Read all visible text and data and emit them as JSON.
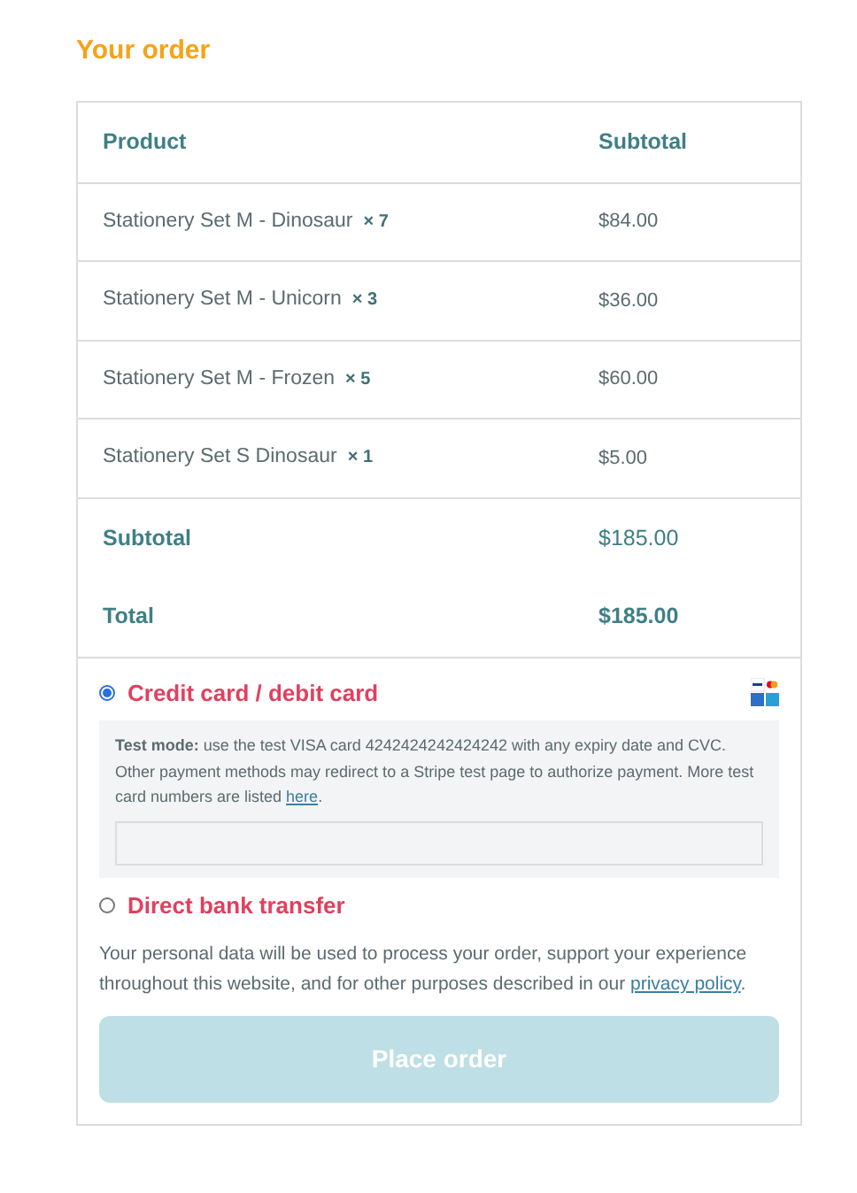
{
  "title": "Your order",
  "table": {
    "columns": [
      "Product",
      "Subtotal"
    ],
    "items": [
      {
        "name": "Stationery Set M - Dinosaur",
        "quantity": "× 7",
        "price": "$84.00"
      },
      {
        "name": "Stationery Set M - Unicorn",
        "quantity": "× 3",
        "price": "$36.00"
      },
      {
        "name": "Stationery Set M - Frozen",
        "quantity": "× 5",
        "price": "$60.00"
      },
      {
        "name": "Stationery Set S Dinosaur",
        "quantity": "× 1",
        "price": "$5.00"
      }
    ],
    "totals": [
      {
        "label": "Subtotal",
        "value": "$185.00",
        "kind": "subtotal"
      },
      {
        "label": "Total",
        "value": "$185.00",
        "kind": "total"
      }
    ]
  },
  "payment_methods": [
    {
      "label": "Credit card / debit card",
      "selected": true,
      "cards": true,
      "note": {
        "text": "**Test mode:** use the test VISA card 4242424242424242 with any expiry date and CVC. Other payment methods may redirect to a Stripe test page to authorize payment. More test card numbers are listed ",
        "link": "here",
        "after": "."
      }
    },
    {
      "label": "Direct bank transfer",
      "selected": false,
      "cards": false
    }
  ],
  "privacy": {
    "text": "Your personal data will be used to process your order, support your experience throughout this website, and for other purposes described in our ",
    "link": "privacy policy",
    "after": "."
  },
  "place_order": {
    "label": "Place order",
    "disabled": true
  }
}
